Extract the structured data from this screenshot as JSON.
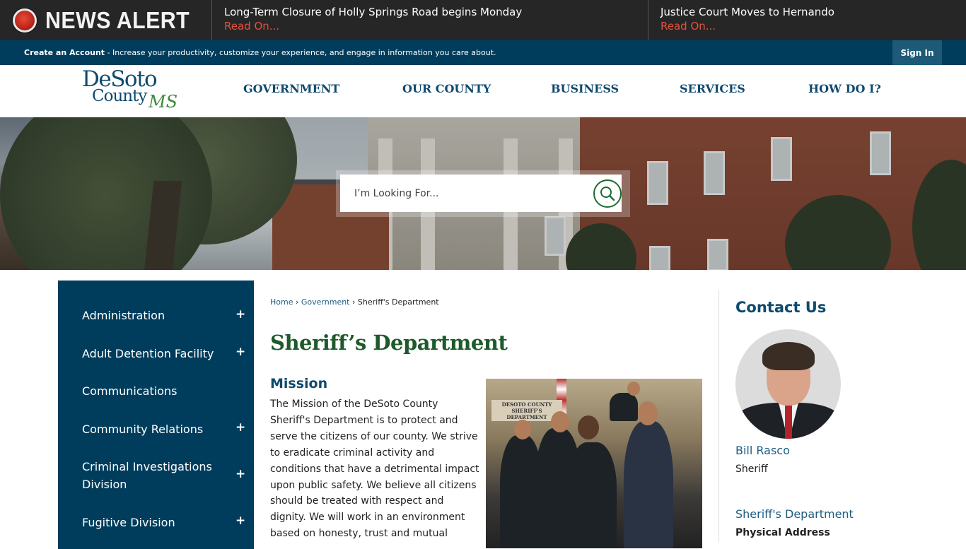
{
  "alert": {
    "label": "NEWS ALERT",
    "items": [
      {
        "headline": "Long-Term Closure of Holly Springs Road begins Monday",
        "link": "Read On..."
      },
      {
        "headline": "Justice Court Moves to Hernando",
        "link": "Read On..."
      }
    ]
  },
  "account_bar": {
    "create_account": "Create an Account",
    "tagline": " - Increase your productivity, customize your experience, and engage in information you care about.",
    "sign_in": "Sign In"
  },
  "logo": {
    "line1": "DeSoto",
    "line2": "County",
    "state": "MS"
  },
  "nav": {
    "items": [
      "GOVERNMENT",
      "OUR COUNTY",
      "BUSINESS",
      "SERVICES",
      "HOW DO I?"
    ]
  },
  "search": {
    "placeholder": "I’m Looking For..."
  },
  "sidebar": {
    "items": [
      {
        "label": "Administration",
        "expandable": true,
        "plus": "+"
      },
      {
        "label": "Adult Detention Facility",
        "expandable": true,
        "plus": "+"
      },
      {
        "label": "Communications",
        "expandable": false
      },
      {
        "label": "Community Relations",
        "expandable": true,
        "plus": "+"
      },
      {
        "label": "Criminal Investigations Division",
        "expandable": true,
        "plus": "+"
      },
      {
        "label": "Fugitive Division",
        "expandable": true,
        "plus": "+"
      }
    ]
  },
  "breadcrumb": {
    "home": "Home",
    "sep1": " › ",
    "government": "Government",
    "sep2": " › ",
    "current": "Sheriff's Department"
  },
  "main": {
    "title": "Sheriff’s Department",
    "mission_heading": "Mission",
    "mission_text": "The Mission of the DeSoto County Sheriff's Department is to protect and serve the citizens of our county. We strive to eradicate criminal activity and conditions that have a detrimental impact upon public safety. We believe all citizens should be treated with respect and dignity. We will work in an environment based on honesty, trust and mutual",
    "photo_banner": "DESOTO COUNTY SHERIFF'S DEPARTMENT"
  },
  "contact": {
    "title": "Contact Us",
    "name": "Bill Rasco",
    "role": "Sheriff",
    "department": "Sheriff's Department",
    "address_label": "Physical Address"
  },
  "colors": {
    "alert_bg": "#262626",
    "alert_link": "#e7503c",
    "account_bar": "#003d5c",
    "nav_text": "#0f4a6e",
    "title_green": "#1e5a2b",
    "sidebar_bg": "#003d5c"
  }
}
